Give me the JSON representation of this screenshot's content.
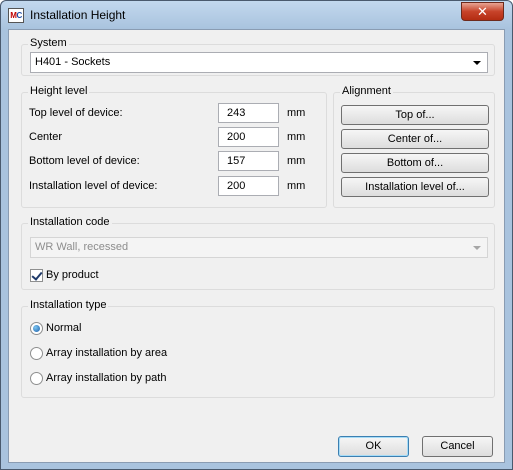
{
  "window": {
    "title": "Installation Height",
    "app_icon_m": "M",
    "app_icon_c": "C",
    "close_glyph": "✕"
  },
  "system": {
    "label": "System",
    "selected": "H401 - Sockets"
  },
  "height_level": {
    "label": "Height level",
    "rows": [
      {
        "label": "Top level of device:",
        "value": "243",
        "unit": "mm"
      },
      {
        "label": "Center",
        "value": "200",
        "unit": "mm"
      },
      {
        "label": "Bottom level of device:",
        "value": "157",
        "unit": "mm"
      },
      {
        "label": "Installation level of device:",
        "value": "200",
        "unit": "mm"
      }
    ]
  },
  "alignment": {
    "label": "Alignment",
    "buttons": [
      "Top of...",
      "Center of...",
      "Bottom of...",
      "Installation level of..."
    ]
  },
  "installation_code": {
    "label": "Installation code",
    "selected": "WR Wall, recessed",
    "by_product_label": "By product",
    "by_product_checked": true
  },
  "installation_type": {
    "label": "Installation type",
    "options": [
      {
        "label": "Normal",
        "selected": true
      },
      {
        "label": "Array installation by area",
        "selected": false
      },
      {
        "label": "Array installation by path",
        "selected": false
      }
    ]
  },
  "footer": {
    "ok_label": "OK",
    "cancel_label": "Cancel"
  }
}
